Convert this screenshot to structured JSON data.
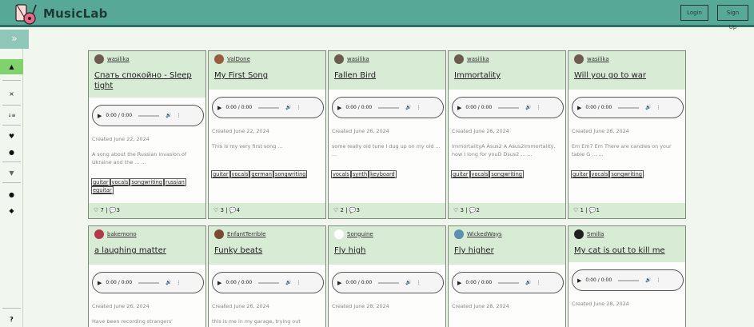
{
  "app": {
    "brand": "MusicLab",
    "login_label": "Login",
    "signup_label": "Sign Up"
  },
  "sidebar": {
    "collapse_glyph": "»",
    "items": [
      {
        "name": "home",
        "glyph": "▲"
      },
      {
        "name": "close",
        "glyph": "×"
      },
      {
        "name": "sort",
        "glyph": "↓≡"
      },
      {
        "name": "favorites",
        "glyph": "♥"
      },
      {
        "name": "recent",
        "glyph": "●"
      },
      {
        "name": "filter",
        "glyph": "▼"
      },
      {
        "name": "profile",
        "glyph": "●"
      },
      {
        "name": "tags",
        "glyph": "◆"
      },
      {
        "name": "help",
        "glyph": "?"
      }
    ]
  },
  "player": {
    "time": "0:00 / 0:00",
    "play_glyph": "▶",
    "volume_glyph": "🔊",
    "menu_glyph": "⋮"
  },
  "cards": [
    {
      "author": "wasilika",
      "avatar_color": "#6d5b4f",
      "title": "Спать спокойно - Sleep tight",
      "created": "Created June 22, 2024",
      "description": "A song about the Russian invasion of Ukraine and the ... ...",
      "tags": [
        "guitar",
        "vocals",
        "songwriting",
        "russian",
        "eguitar"
      ],
      "likes": "7",
      "comments": "3"
    },
    {
      "author": "ValDone",
      "avatar_color": "#9b5b3f",
      "title": "My First Song",
      "created": "Created June 22, 2024",
      "description": "This is my very first song ...",
      "tags": [
        "guitar",
        "vocals",
        "german",
        "songwriting"
      ],
      "likes": "3",
      "comments": "4"
    },
    {
      "author": "wasilika",
      "avatar_color": "#6d5b4f",
      "title": "Fallen Bird",
      "created": "Created June 26, 2024",
      "description": "some really old tune I dug up on my old ... ...",
      "tags": [
        "vocals",
        "synth",
        "keyboard"
      ],
      "likes": "2",
      "comments": "3"
    },
    {
      "author": "wasilika",
      "avatar_color": "#6d5b4f",
      "title": "Immortality",
      "created": "Created June 26, 2024",
      "description": "ImmortalityA Asus2 A Asus2Immortality, how I long for youD Dsus2 ... ...",
      "tags": [
        "guitar",
        "vocals",
        "songwriting"
      ],
      "likes": "3",
      "comments": "2"
    },
    {
      "author": "wasilika",
      "avatar_color": "#6d5b4f",
      "title": "Will you go to war",
      "created": "Created June 26, 2024",
      "description": "Em Em7 Em There are candles on your table G ... ...",
      "tags": [
        "guitar",
        "vocals",
        "songwriting"
      ],
      "likes": "1",
      "comments": "1"
    },
    {
      "author": "bakemono",
      "avatar_color": "#b3394a",
      "title": "a laughing matter",
      "created": "Created June 26, 2024",
      "description": "Have been recording strangers'",
      "tags": [],
      "likes": "",
      "comments": ""
    },
    {
      "author": "EnfantTerrible",
      "avatar_color": "#7a4b33",
      "title": "Funky beats",
      "created": "Created June 26, 2024",
      "description": "this is me in my garage, trying out",
      "tags": [],
      "likes": "",
      "comments": ""
    },
    {
      "author": "Songuine",
      "avatar_color": "#ffffff",
      "title": "Fly high",
      "created": "Created June 28, 2024",
      "description": "",
      "tags": [],
      "likes": "",
      "comments": ""
    },
    {
      "author": "WickedWays",
      "avatar_color": "#5c8fb0",
      "title": "Fly higher",
      "created": "Created June 28, 2024",
      "description": "",
      "tags": [],
      "likes": "",
      "comments": ""
    },
    {
      "author": "Smilla",
      "avatar_color": "#222222",
      "title": "My cat is out to kill me",
      "created": "Created June 28, 2024",
      "description": "",
      "tags": [],
      "likes": "",
      "comments": ""
    }
  ]
}
